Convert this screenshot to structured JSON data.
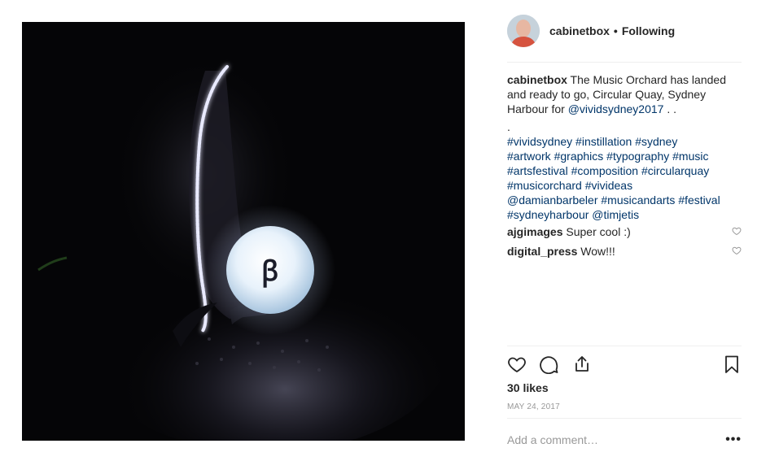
{
  "post": {
    "author": "cabinetbox",
    "separator": "•",
    "follow_state": "Following",
    "photo_alt": "Glowing white sphere with logo at night beside a lit curving light strip",
    "photo_logo_text": "ꞵ"
  },
  "caption": {
    "author": "cabinetbox",
    "text": "The Music Orchard has landed and ready to go, Circular Quay, Sydney Harbour for",
    "mention": "@vividsydney2017",
    "trail": " . .",
    "dot_line": ".",
    "tags_line1": [
      "#vividsydney",
      "#instillation",
      "#sydney"
    ],
    "tags_line2": [
      "#artwork",
      "#graphics",
      "#typography",
      "#music"
    ],
    "tags_line3": [
      "#artsfestival",
      "#composition",
      "#circularquay"
    ],
    "tags_line4": [
      "#musicorchard",
      "#vivideas"
    ],
    "tags_line5": [
      "@damianbarbeler",
      "#musicandarts",
      "#festival"
    ],
    "tags_line6": [
      "#sydneyharbour",
      "@timjetis"
    ]
  },
  "comments": [
    {
      "user": "ajgimages",
      "text": "Super cool :)"
    },
    {
      "user": "digital_press",
      "text": "Wow!!!"
    }
  ],
  "actions": {
    "like_icon": "heart-icon",
    "comment_icon": "comment-icon",
    "share_icon": "share-icon",
    "save_icon": "bookmark-icon"
  },
  "likes": "30 likes",
  "date": "MAY 24, 2017",
  "add_comment": {
    "placeholder": "Add a comment…"
  },
  "more": "•••",
  "colors": {
    "link": "#003569",
    "muted": "#999999",
    "text": "#262626",
    "divider": "#efefef"
  }
}
